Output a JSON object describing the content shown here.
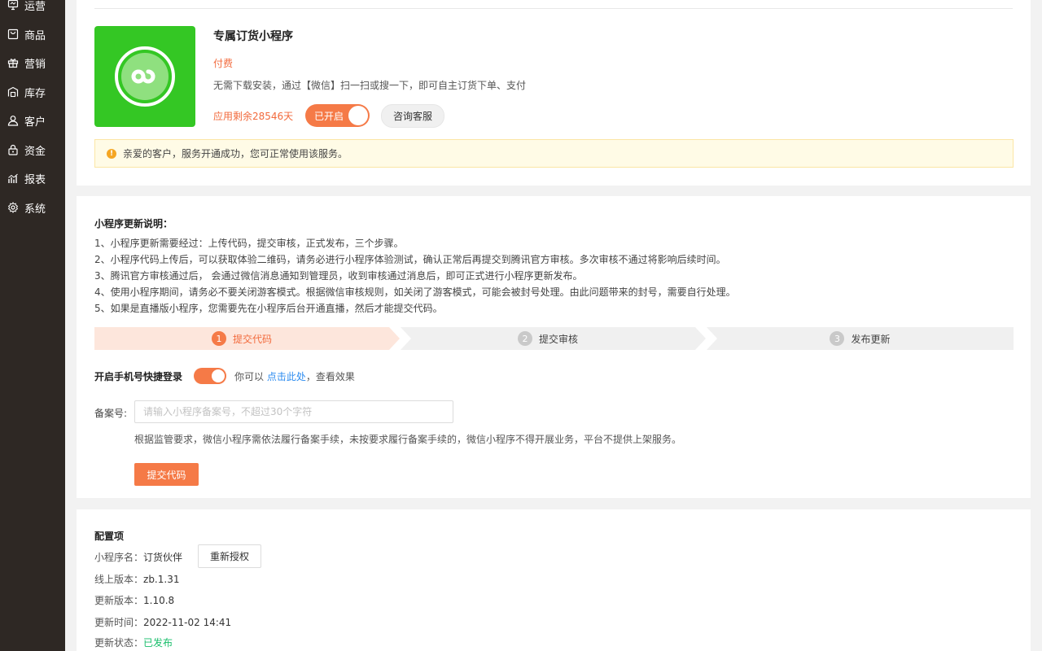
{
  "sidebar": {
    "items": [
      {
        "label": "运营",
        "icon": "monitor-icon"
      },
      {
        "label": "商品",
        "icon": "bag-icon"
      },
      {
        "label": "营销",
        "icon": "gift-icon"
      },
      {
        "label": "库存",
        "icon": "warehouse-icon"
      },
      {
        "label": "客户",
        "icon": "user-icon"
      },
      {
        "label": "资金",
        "icon": "lock-icon"
      },
      {
        "label": "报表",
        "icon": "chart-icon"
      },
      {
        "label": "系统",
        "icon": "gear-icon"
      }
    ]
  },
  "app": {
    "title": "专属订货小程序",
    "paid": "付费",
    "description": "无需下载安装，通过【微信】扫一扫或搜一下，即可自主订货下单、支付",
    "remaining": "应用剩余28546天",
    "toggle_label": "已开启",
    "consult_label": "咨询客服",
    "notice": "亲爱的客户，服务开通成功，您可正常使用该服务。"
  },
  "update": {
    "title": "小程序更新说明：",
    "lines": [
      "1、小程序更新需要经过：上传代码，提交审核，正式发布，三个步骤。",
      "2、小程序代码上传后，可以获取体验二维码，请务必进行小程序体验测试，确认正常后再提交到腾讯官方审核。多次审核不通过将影响后续时间。",
      "3、腾讯官方审核通过后， 会通过微信消息通知到管理员，收到审核通过消息后，即可正式进行小程序更新发布。",
      "4、使用小程序期间，请务必不要关闭游客模式。根据微信审核规则，如关闭了游客模式，可能会被封号处理。由此问题带来的封号，需要自行处理。",
      "5、如果是直播版小程序，您需要先在小程序后台开通直播，然后才能提交代码。"
    ],
    "steps": [
      {
        "num": "1",
        "label": "提交代码"
      },
      {
        "num": "2",
        "label": "提交审核"
      },
      {
        "num": "3",
        "label": "发布更新"
      }
    ],
    "fast_login_label": "开启手机号快捷登录",
    "fast_login_tip_prefix": "你可以",
    "fast_login_link": "点击此处",
    "fast_login_tip_suffix": "，查看效果",
    "record_label": "备案号:",
    "record_placeholder": "请输入小程序备案号，不超过30个字符",
    "record_hint": "根据监管要求，微信小程序需依法履行备案手续，未按要求履行备案手续的，微信小程序不得开展业务，平台不提供上架服务。",
    "submit_label": "提交代码"
  },
  "config": {
    "title": "配置项",
    "name_key": "小程序名：",
    "name_value": "订货伙伴",
    "reauth_label": "重新授权",
    "online_version_key": "线上版本：",
    "online_version_value": "zb.1.31",
    "update_version_key": "更新版本：",
    "update_version_value": "1.10.8",
    "update_time_key": "更新时间：",
    "update_time_value": "2022-11-02 14:41",
    "update_status_key": "更新状态：",
    "update_status_value": "已发布"
  },
  "colors": {
    "accent": "#f57a47",
    "sidebar_bg": "#2e2824",
    "app_logo_bg": "#34c724",
    "link": "#2d8cf0",
    "success": "#19be6b"
  }
}
